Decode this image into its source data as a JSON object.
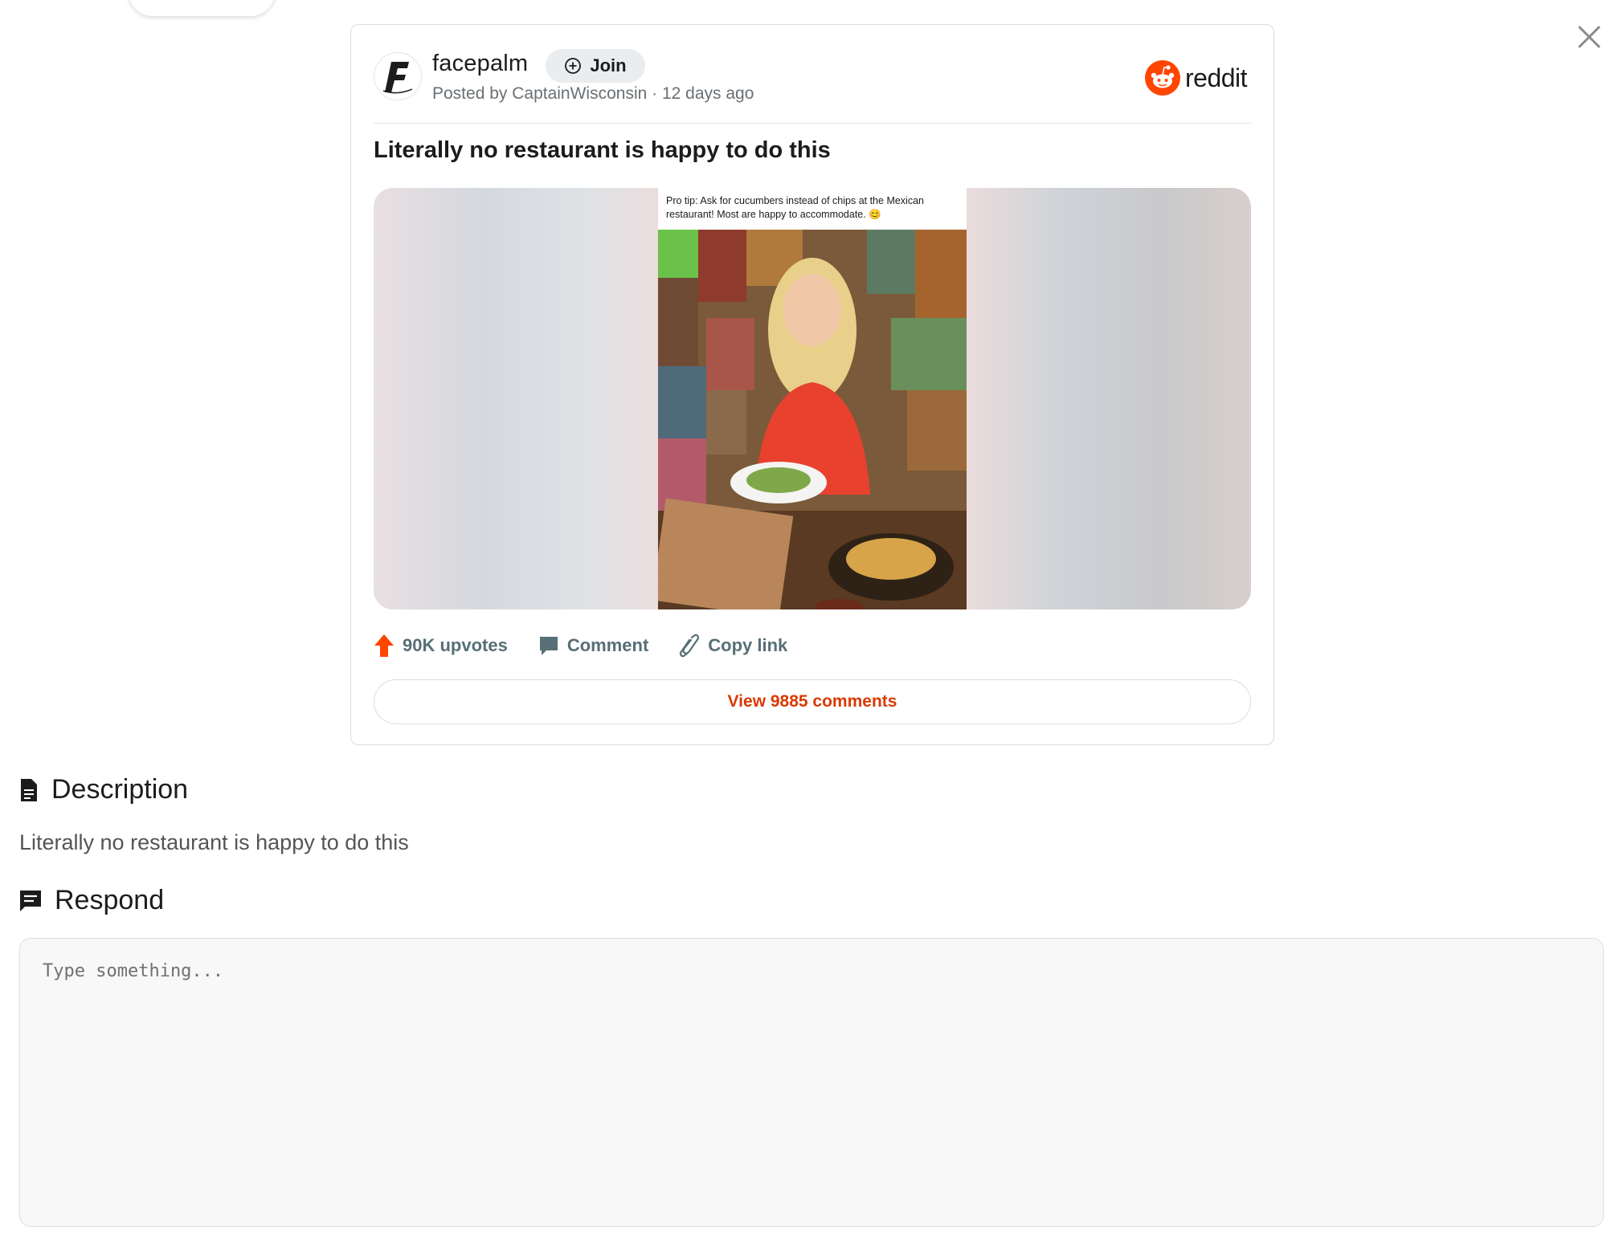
{
  "post": {
    "subreddit": "facepalm",
    "join_label": "Join",
    "meta": "Posted by CaptainWisconsin · 12 days ago",
    "brand": "reddit",
    "title": "Literally no restaurant is happy to do this",
    "image_caption": "Pro tip: Ask for cucumbers instead of chips at the Mexican restaurant! Most are happy to accommodate. 😊",
    "upvotes_label": "90K upvotes",
    "comment_label": "Comment",
    "copy_link_label": "Copy link",
    "view_comments_label": "View 9885 comments"
  },
  "description": {
    "heading": "Description",
    "text": "Literally no restaurant is happy to do this"
  },
  "respond": {
    "heading": "Respond",
    "placeholder": "Type something..."
  },
  "icons": {
    "close": "close-icon",
    "join": "plus-circle-icon",
    "upvote": "upvote-arrow-icon",
    "comment": "comment-bubble-icon",
    "link": "link-icon",
    "description": "document-icon",
    "respond": "chat-icon"
  },
  "colors": {
    "reddit_orange": "#ff4500",
    "link_red": "#d93a00",
    "action_gray": "#576f76"
  }
}
